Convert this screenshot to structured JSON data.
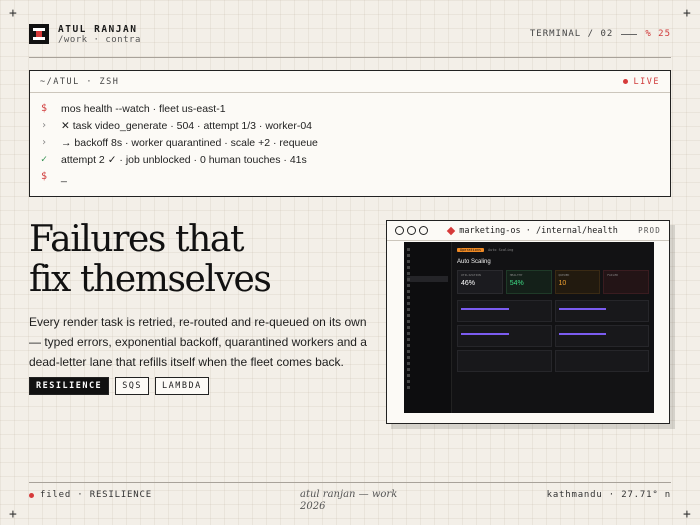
{
  "brand": {
    "name": "ATUL RANJAN",
    "path": "/work · contra"
  },
  "header": {
    "section": "TERMINAL / 02",
    "percent": "% 25"
  },
  "terminal": {
    "title": "~/ATUL · ZSH",
    "status": "LIVE",
    "lines": [
      {
        "prefix": "$",
        "text": "mos health --watch · fleet us-east-1"
      },
      {
        "prefix": "›",
        "text": "✕ task video_generate · 504 · attempt 1/3 · worker-04"
      },
      {
        "prefix": "›",
        "text": "→ backoff 8s · worker quarantined · scale +2 · requeue"
      },
      {
        "prefix": "✓",
        "text": "attempt 2 ✓ · job unblocked · 0 human touches · 41s"
      },
      {
        "prefix": "$",
        "text": "_"
      }
    ]
  },
  "headline": {
    "line1": "Failures that",
    "line2": "fix themselves"
  },
  "body": "Every render task is retried, re-routed and re-queued on its own — typed errors, exponential backoff, quarantined workers and a dead-letter lane that refills itself when the fleet comes back.",
  "tags": [
    "RESILIENCE",
    "SQS",
    "LAMBDA"
  ],
  "screenshot": {
    "url": "marketing-os · /internal/health",
    "env": "PROD",
    "app": {
      "chip": "Operations",
      "tab": "Auto Scaling",
      "title": "Auto Scaling",
      "stats": [
        {
          "label": "UTILIZATION",
          "value": "46%",
          "color": "#ffffff"
        },
        {
          "label": "HEALTHY",
          "value": "54%",
          "color": "#3ddc84"
        },
        {
          "label": "QUEUED",
          "value": "10",
          "color": "#f0a030"
        },
        {
          "label": "FAILED",
          "value": "",
          "color": "#e05050"
        }
      ]
    }
  },
  "footer": {
    "left_status": "filed · RESILIENCE",
    "author": "atul ranjan — work",
    "year": "2026",
    "location": "kathmandu · 27.71° n"
  },
  "colors": {
    "accent": "#d63a3a",
    "background": "#f3efe8",
    "ink": "#111111"
  }
}
